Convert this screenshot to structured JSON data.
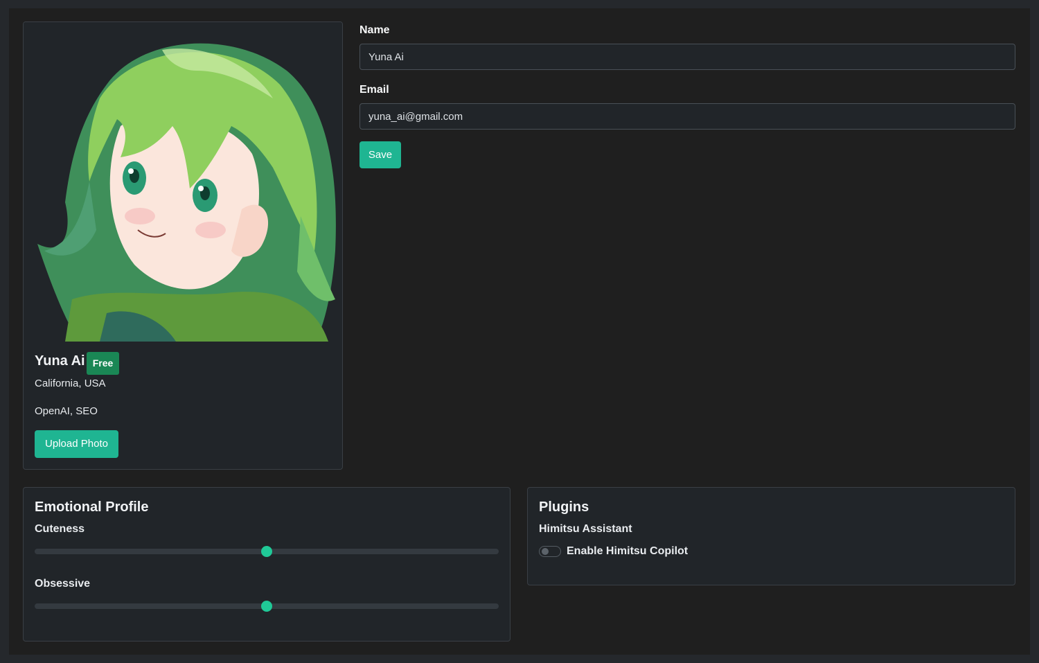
{
  "profile": {
    "name": "Yuna Ai",
    "badge": "Free",
    "location": "California, USA",
    "tags": "OpenAI, SEO",
    "upload_label": "Upload Photo"
  },
  "form": {
    "name_label": "Name",
    "name_value": "Yuna Ai",
    "email_label": "Email",
    "email_value": "yuna_ai@gmail.com",
    "save_label": "Save"
  },
  "emotional_profile": {
    "title": "Emotional Profile",
    "sliders": [
      {
        "label": "Cuteness",
        "value": 50
      },
      {
        "label": "Obsessive",
        "value": 50
      }
    ]
  },
  "plugins": {
    "title": "Plugins",
    "items": [
      {
        "name": "Himitsu Assistant",
        "toggle_label": "Enable Himitsu Copilot",
        "enabled": false
      }
    ]
  },
  "colors": {
    "accent": "#1fb592",
    "badge": "#1a8755",
    "background": "#1f1f1f",
    "card": "#212529"
  }
}
